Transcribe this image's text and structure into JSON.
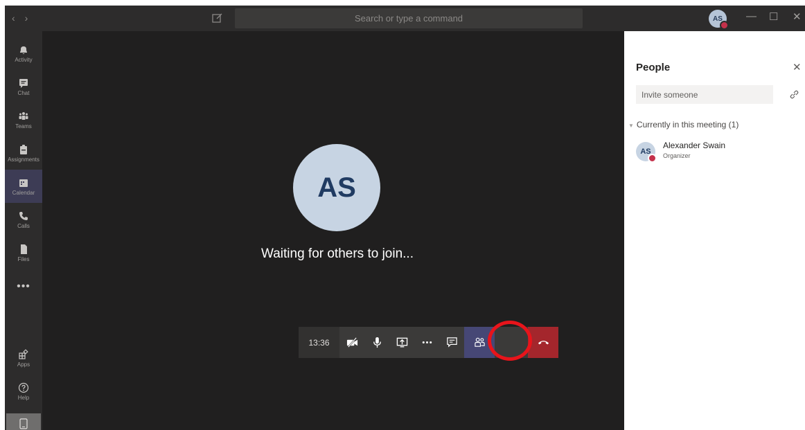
{
  "titlebar": {
    "search_placeholder": "Search or type a command",
    "avatar_initials": "AS",
    "nav_back": "‹",
    "nav_forward": "›",
    "minimize": "—",
    "maximize": "☐",
    "close": "✕"
  },
  "rail": {
    "items": [
      {
        "label": "Activity",
        "icon": "bell-icon"
      },
      {
        "label": "Chat",
        "icon": "chat-icon"
      },
      {
        "label": "Teams",
        "icon": "teams-icon"
      },
      {
        "label": "Assignments",
        "icon": "assignments-icon"
      },
      {
        "label": "Calendar",
        "icon": "calendar-icon",
        "active": true
      },
      {
        "label": "Calls",
        "icon": "phone-icon"
      },
      {
        "label": "Files",
        "icon": "file-icon"
      }
    ],
    "more": "•••",
    "apps_label": "Apps",
    "help_label": "Help"
  },
  "stage": {
    "avatar_initials": "AS",
    "waiting_text": "Waiting for others to join..."
  },
  "controls": {
    "timer": "13:36"
  },
  "panel": {
    "title": "People",
    "invite_placeholder": "Invite someone",
    "section_label": "Currently in this meeting (1)",
    "participant": {
      "initials": "AS",
      "name": "Alexander Swain",
      "role": "Organizer"
    }
  },
  "colors": {
    "background": "#201f1f",
    "accent": "#464775",
    "hangup": "#a4262c",
    "highlight": "#e8141b",
    "presence_busy": "#c4314b"
  }
}
